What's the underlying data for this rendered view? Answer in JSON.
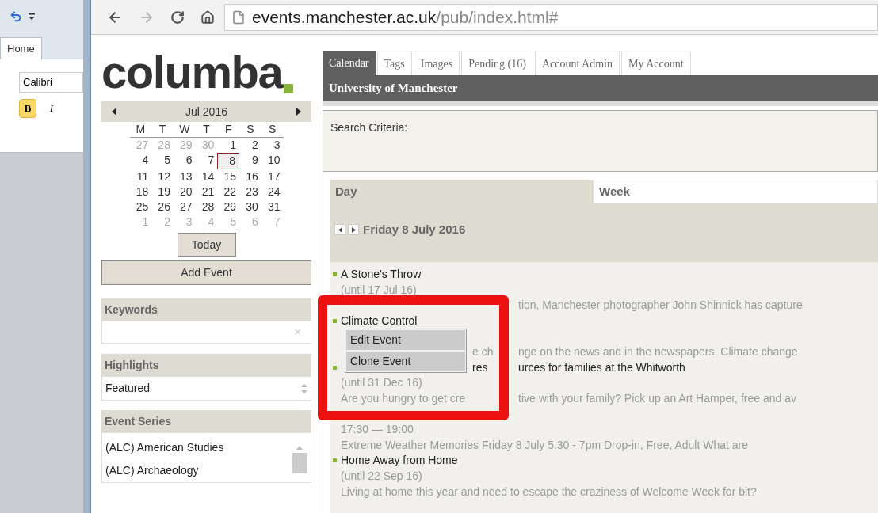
{
  "word": {
    "tab": "Home",
    "font": "Calibri",
    "format_buttons": [
      {
        "label": "B",
        "kind": "bold",
        "selected": true
      },
      {
        "label": "I",
        "kind": "italic",
        "selected": false
      }
    ]
  },
  "browser": {
    "url_host": "events.manchester.ac.uk",
    "url_path": "/pub/index.html#"
  },
  "logo": "columba",
  "calendar": {
    "month": "Jul 2016",
    "weekdays": [
      "M",
      "T",
      "W",
      "T",
      "F",
      "S",
      "S"
    ],
    "weeks": [
      [
        {
          "d": "27",
          "muted": true,
          "selected": false
        },
        {
          "d": "28",
          "muted": true,
          "selected": false
        },
        {
          "d": "29",
          "muted": true,
          "selected": false
        },
        {
          "d": "30",
          "muted": true,
          "selected": false
        },
        {
          "d": "1",
          "muted": false,
          "selected": false
        },
        {
          "d": "2",
          "muted": false,
          "selected": false
        },
        {
          "d": "3",
          "muted": false,
          "selected": false
        }
      ],
      [
        {
          "d": "4",
          "muted": false,
          "selected": false
        },
        {
          "d": "5",
          "muted": false,
          "selected": false
        },
        {
          "d": "6",
          "muted": false,
          "selected": false
        },
        {
          "d": "7",
          "muted": false,
          "selected": false
        },
        {
          "d": "8",
          "muted": false,
          "selected": true
        },
        {
          "d": "9",
          "muted": false,
          "selected": false
        },
        {
          "d": "10",
          "muted": false,
          "selected": false
        }
      ],
      [
        {
          "d": "11",
          "muted": false,
          "selected": false
        },
        {
          "d": "12",
          "muted": false,
          "selected": false
        },
        {
          "d": "13",
          "muted": false,
          "selected": false
        },
        {
          "d": "14",
          "muted": false,
          "selected": false
        },
        {
          "d": "15",
          "muted": false,
          "selected": false
        },
        {
          "d": "16",
          "muted": false,
          "selected": false
        },
        {
          "d": "17",
          "muted": false,
          "selected": false
        }
      ],
      [
        {
          "d": "18",
          "muted": false,
          "selected": false
        },
        {
          "d": "19",
          "muted": false,
          "selected": false
        },
        {
          "d": "20",
          "muted": false,
          "selected": false
        },
        {
          "d": "21",
          "muted": false,
          "selected": false
        },
        {
          "d": "22",
          "muted": false,
          "selected": false
        },
        {
          "d": "23",
          "muted": false,
          "selected": false
        },
        {
          "d": "24",
          "muted": false,
          "selected": false
        }
      ],
      [
        {
          "d": "25",
          "muted": false,
          "selected": false
        },
        {
          "d": "26",
          "muted": false,
          "selected": false
        },
        {
          "d": "27",
          "muted": false,
          "selected": false
        },
        {
          "d": "28",
          "muted": false,
          "selected": false
        },
        {
          "d": "29",
          "muted": false,
          "selected": false
        },
        {
          "d": "30",
          "muted": false,
          "selected": false
        },
        {
          "d": "31",
          "muted": false,
          "selected": false
        }
      ],
      [
        {
          "d": "1",
          "muted": true,
          "selected": false
        },
        {
          "d": "2",
          "muted": true,
          "selected": false
        },
        {
          "d": "3",
          "muted": true,
          "selected": false
        },
        {
          "d": "4",
          "muted": true,
          "selected": false
        },
        {
          "d": "5",
          "muted": true,
          "selected": false
        },
        {
          "d": "6",
          "muted": true,
          "selected": false
        },
        {
          "d": "7",
          "muted": true,
          "selected": false
        }
      ]
    ],
    "today": "Today"
  },
  "add_event": "Add Event",
  "keywords": {
    "title": "Keywords",
    "clear": "×"
  },
  "highlights": {
    "title": "Highlights",
    "value": "Featured"
  },
  "event_series": {
    "title": "Event Series",
    "items": [
      "(ALC) American Studies",
      "(ALC) Archaeology"
    ]
  },
  "tabs": [
    {
      "label": "Calendar",
      "selected": true
    },
    {
      "label": "Tags",
      "selected": false
    },
    {
      "label": "Images",
      "selected": false
    },
    {
      "label": "Pending (16)",
      "selected": false
    },
    {
      "label": "Account Admin",
      "selected": false
    },
    {
      "label": "My Account",
      "selected": false
    }
  ],
  "site_title": "University of Manchester",
  "search_criteria": "Search Criteria:",
  "views": [
    {
      "label": "Day",
      "selected": true
    },
    {
      "label": "Week",
      "selected": false
    }
  ],
  "date": "Friday 8 July 2016",
  "lines": [
    {
      "kind": "title",
      "parts": [
        "A Stone's Throw"
      ]
    },
    {
      "kind": "when",
      "parts": [
        "(until 17 Jul 16)"
      ]
    },
    {
      "kind": "framedesc",
      "parts": [
        "tion, Manchester photographer John Shinnick has capture"
      ]
    },
    {
      "kind": "title",
      "parts": [
        "Climate Control"
      ]
    },
    {
      "kind": "gap"
    },
    {
      "kind": "menudesc",
      "parts": [
        "e ch",
        "nge on the news and in the newspapers. Climate change"
      ]
    },
    {
      "kind": "menutitle",
      "parts": [
        "res",
        "urces for families at the Whitworth"
      ]
    },
    {
      "kind": "when",
      "parts": [
        "(until 31 Dec 16)"
      ]
    },
    {
      "kind": "desc",
      "parts": [
        "Are you hungry to get cre",
        "tive with your family? Pick up an Art Hamper, free and av"
      ]
    },
    {
      "kind": "gap"
    },
    {
      "kind": "when",
      "parts": [
        "17:30  — 19:00"
      ]
    },
    {
      "kind": "desc",
      "parts": [
        "Extreme Weather Memories Friday 8 July 5.30 - 7pm Drop-in, Free, Adult What are"
      ]
    },
    {
      "kind": "title",
      "parts": [
        "Home Away from Home"
      ]
    },
    {
      "kind": "when",
      "parts": [
        "(until 22 Sep 16)"
      ]
    },
    {
      "kind": "desc",
      "parts": [
        "Living at home this year and need to escape the craziness of Welcome Week for bit?"
      ]
    }
  ],
  "context_menu": [
    {
      "label": "Edit Event",
      "selected": false
    },
    {
      "label": "Clone Event",
      "selected": false
    }
  ],
  "highlight_frame": {
    "kind": "annotation"
  }
}
